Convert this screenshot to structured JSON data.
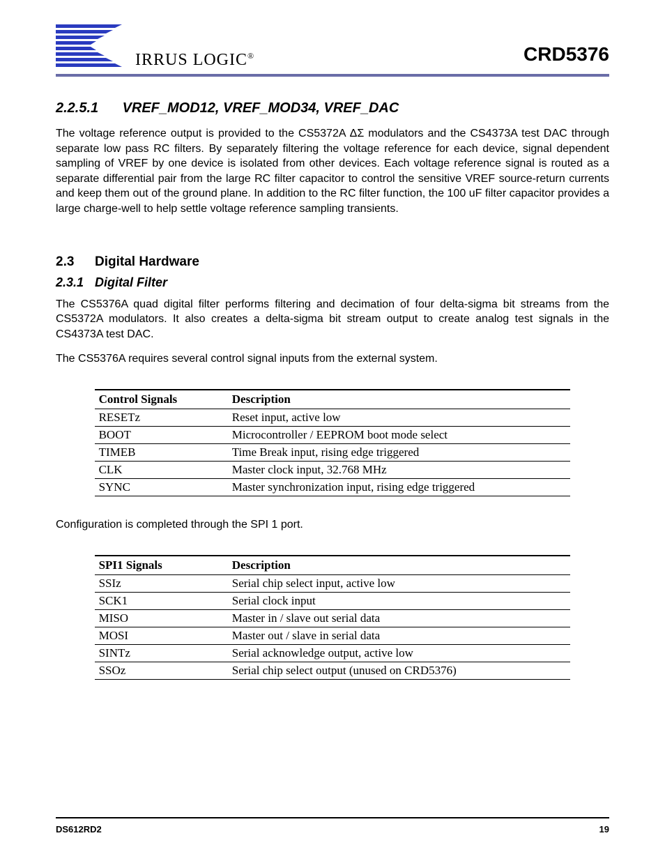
{
  "header": {
    "logo_text": "IRRUS LOGIC",
    "doc_id": "CRD5376"
  },
  "sections": {
    "s2251": {
      "num": "2.2.5.1",
      "title": "VREF_MOD12, VREF_MOD34, VREF_DAC",
      "para": "The voltage reference output is provided to the CS5372A ΔΣ modulators and the CS4373A test DAC through separate low pass RC filters. By separately filtering the voltage reference for each device, signal dependent sampling of VREF by one device is isolated from other devices. Each voltage reference signal is routed as a separate differential pair from the large RC filter capacitor to control the sensitive VREF source-return currents and keep them out of the ground plane. In addition to the RC filter function, the 100 uF filter capacitor provides a large charge-well to help settle voltage reference sampling transients."
    },
    "s23": {
      "num": "2.3",
      "title": "Digital Hardware"
    },
    "s231": {
      "num": "2.3.1",
      "title": "Digital Filter",
      "para1": "The CS5376A quad digital filter performs filtering and decimation of four delta-sigma bit streams from the CS5372A modulators. It also creates a delta-sigma bit stream output to create analog test signals in the CS4373A test DAC.",
      "para2": "The CS5376A requires several control signal inputs from the external system.",
      "para3": "Configuration is completed through the SPI 1 port."
    }
  },
  "table1": {
    "headers": [
      "Control Signals",
      "Description"
    ],
    "rows": [
      [
        "RESETz",
        "Reset input, active low"
      ],
      [
        "BOOT",
        "Microcontroller / EEPROM boot mode select"
      ],
      [
        "TIMEB",
        "Time Break input, rising edge triggered"
      ],
      [
        "CLK",
        "Master clock input, 32.768 MHz"
      ],
      [
        "SYNC",
        "Master synchronization input, rising edge triggered"
      ]
    ]
  },
  "table2": {
    "headers": [
      "SPI1 Signals",
      "Description"
    ],
    "rows": [
      [
        "SSIz",
        "Serial chip select input, active low"
      ],
      [
        "SCK1",
        "Serial clock input"
      ],
      [
        "MISO",
        "Master in / slave out serial data"
      ],
      [
        "MOSI",
        "Master out / slave in serial data"
      ],
      [
        "SINTz",
        "Serial acknowledge output, active low"
      ],
      [
        "SSOz",
        "Serial chip select output (unused on CRD5376)"
      ]
    ]
  },
  "footer": {
    "left": "DS612RD2",
    "right": "19"
  }
}
